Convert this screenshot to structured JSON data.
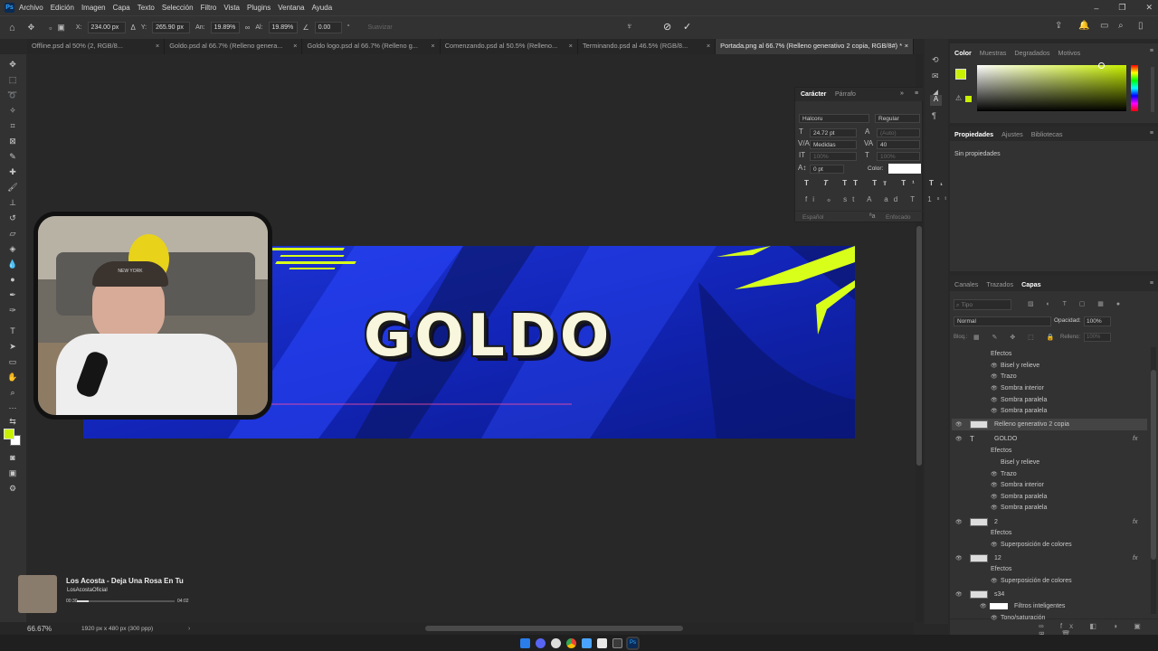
{
  "menu": [
    "Archivo",
    "Edición",
    "Imagen",
    "Capa",
    "Texto",
    "Selección",
    "Filtro",
    "Vista",
    "Plugins",
    "Ventana",
    "Ayuda"
  ],
  "options": {
    "x_label": "X:",
    "x_val": "234.00 px",
    "y_label": "Y:",
    "y_val": "265.90 px",
    "w_label": "An:",
    "w_val": "19.89%",
    "h_label": "Al:",
    "h_val": "19.89%",
    "angle": "0.00",
    "deg": "°",
    "smooth": "Suavizar"
  },
  "tabs": [
    {
      "label": "Offline.psd al 50% (2, RGB/8..."
    },
    {
      "label": "Goldo.psd al 66.7% (Relleno genera..."
    },
    {
      "label": "Goldo logo.psd al 66.7% (Relleno g..."
    },
    {
      "label": "Comenzando.psd al 50.5% (Relleno..."
    },
    {
      "label": "Terminando.psd al 46.5% (RGB/8..."
    },
    {
      "label": "Portada.png al 66.7% (Relleno generativo 2 copia, RGB/8#) *"
    }
  ],
  "tab_close": "×",
  "banner": {
    "title": "GOLDO",
    "webcam_cap": "NEW YORK"
  },
  "status": {
    "zoom": "66.67%",
    "doc": "1920 px x 480 px (300 ppp)"
  },
  "music": {
    "title": "Los Acosta - Deja Una Rosa En Tu",
    "artist": "LosAcostaOficial",
    "elapsed": "00:30",
    "total": "04:02"
  },
  "character": {
    "tab1": "Carácter",
    "tab2": "Párrafo",
    "font": "Halcoru",
    "style": "Regular",
    "size": "24.72 pt",
    "leading": "(Auto)",
    "kerning": "Medidas",
    "tracking": "40",
    "vscale": "100%",
    "hscale": "100%",
    "baseline": "0 pt",
    "color_label": "Color:",
    "lang": "Español",
    "aa": "Enfocado"
  },
  "color_panel": {
    "tabs": [
      "Color",
      "Muestras",
      "Degradados",
      "Motivos"
    ],
    "fg": "#c8f000"
  },
  "props": {
    "tabs": [
      "Propiedades",
      "Ajustes",
      "Bibliotecas"
    ],
    "text": "Sin propiedades"
  },
  "layers_panel": {
    "tabs": [
      "Canales",
      "Trazados",
      "Capas"
    ],
    "search": "Tipo",
    "blend": "Normal",
    "opacity_label": "Opacidad:",
    "opacity": "100%",
    "lock_label": "Bloq.:",
    "fill_label": "Relleno:",
    "fill": "100%",
    "rows": [
      {
        "label": "Efectos",
        "indent": 1
      },
      {
        "label": "Bisel y relieve",
        "indent": 2
      },
      {
        "label": "Trazo",
        "indent": 2
      },
      {
        "label": "Sombra interior",
        "indent": 2
      },
      {
        "label": "Sombra paralela",
        "indent": 2
      },
      {
        "label": "Sombra paralela",
        "indent": 2
      },
      {
        "label": "Relleno generativo 2 copia",
        "indent": 0
      },
      {
        "label": "GOLDO",
        "indent": 0
      },
      {
        "label": "Efectos",
        "indent": 1
      },
      {
        "label": "Bisel y relieve",
        "indent": 2
      },
      {
        "label": "Trazo",
        "indent": 2
      },
      {
        "label": "Sombra interior",
        "indent": 2
      },
      {
        "label": "Sombra paralela",
        "indent": 2
      },
      {
        "label": "Sombra paralela",
        "indent": 2
      },
      {
        "label": "2",
        "indent": 0
      },
      {
        "label": "Efectos",
        "indent": 1
      },
      {
        "label": "Superposición de colores",
        "indent": 2
      },
      {
        "label": "12",
        "indent": 0
      },
      {
        "label": "Efectos",
        "indent": 1
      },
      {
        "label": "Superposición de colores",
        "indent": 2
      },
      {
        "label": "s34",
        "indent": 0
      },
      {
        "label": "Filtros inteligentes",
        "indent": 1
      },
      {
        "label": "Tono/saturación",
        "indent": 2
      }
    ],
    "fx": "fx"
  },
  "colors": {
    "accent": "#31a8ff",
    "lime": "#c8f000",
    "banner_blue": "#1a2fd0"
  }
}
